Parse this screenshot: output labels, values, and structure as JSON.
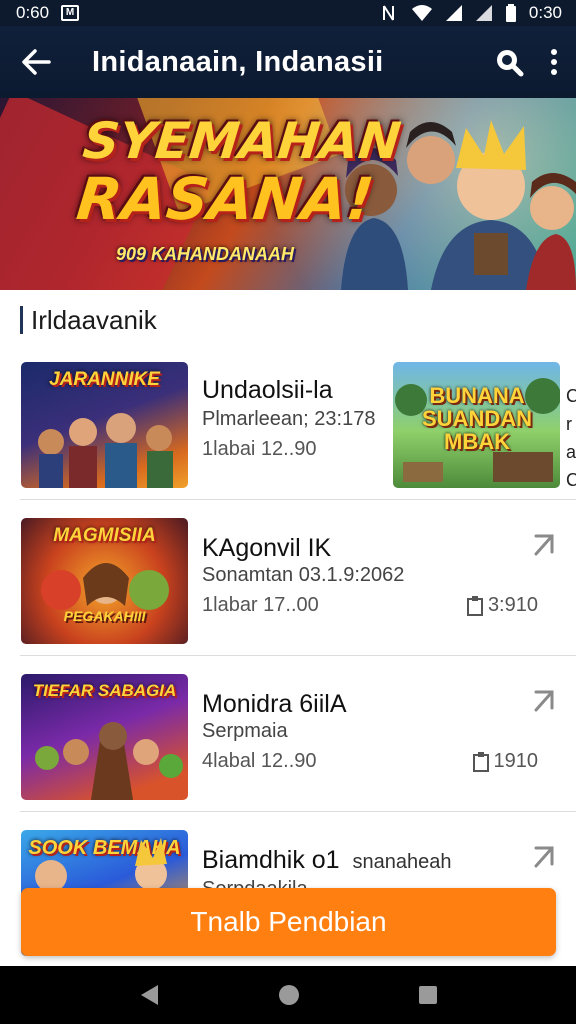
{
  "status_bar": {
    "time_left": "0:60",
    "time_right": "0:30",
    "notification_glyph": "M",
    "icons": [
      "nfc-icon",
      "wifi-icon",
      "signal-icon",
      "signal-icon",
      "battery-icon"
    ]
  },
  "app_bar": {
    "title": "Inidanaain, Indanasii",
    "back_icon": "arrow-left-icon",
    "search_icon": "search-icon",
    "more_icon": "more-vert-icon"
  },
  "hero": {
    "title_line1": "SYEMAHAN",
    "title_line2": "RASANA!",
    "subtitle": "909 KAHANDANAAH"
  },
  "section": {
    "title": "Irldaavanik"
  },
  "items": [
    {
      "thumb_text": "JARANNIKE",
      "title": "Undaolsii-la",
      "subtitle": "Plmarleean; 23:178",
      "meta": "1labai 12..90",
      "second_thumb_text": "BUNANA SUANDAN MBAK",
      "edge_text": [
        "C",
        "r",
        "a",
        "C"
      ]
    },
    {
      "thumb_text": "MAGMISIIA",
      "thumb_sub": "PEGAKAHIII",
      "title": "KAgonvil IK",
      "subtitle": "Sonamtan 03.1.9:2062",
      "meta": "1labar 17..00",
      "count": "3:910",
      "arrow_icon": "chevron-arrow-icon"
    },
    {
      "thumb_text": "TIEFAR SABAGIA",
      "title": "Monidra 6iilA",
      "subtitle": "Serpmaia",
      "meta": "4labal 12..90",
      "count": "1910",
      "arrow_icon": "chevron-arrow-icon"
    },
    {
      "thumb_text": "SOOK BEMAHA",
      "title": "Biamdhik ο1",
      "title_extra": "snanaheah",
      "subtitle": "Sorpdaakila",
      "arrow_icon": "chevron-arrow-icon"
    }
  ],
  "cta": {
    "label": "Tnalb Pendbian"
  },
  "nav": {
    "back": "triangle-back-icon",
    "home": "circle-home-icon",
    "recents": "square-recents-icon"
  },
  "colors": {
    "app_bar": "#10203a",
    "accent": "#ff7f11",
    "divider": "#dcdcdc"
  }
}
